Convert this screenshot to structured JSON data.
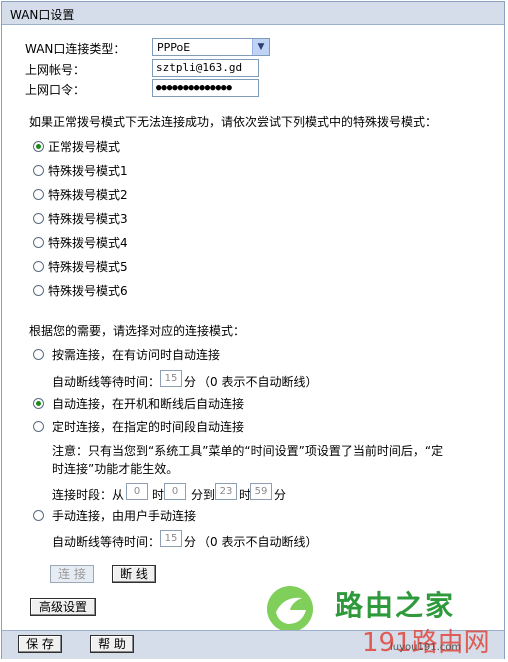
{
  "title": "WAN口设置",
  "wan": {
    "type_label": "WAN口连接类型：",
    "type_value": "PPPoE",
    "account_label": "上网帐号：",
    "account_value": "sztpli@163.gd",
    "password_label": "上网口令：",
    "password_value": "●●●●●●●●●●●●●●"
  },
  "dial_hint": "如果正常拨号模式下无法连接成功，请依次尝试下列模式中的特殊拨号模式：",
  "dial_modes": [
    {
      "label": "正常拨号模式",
      "checked": true
    },
    {
      "label": "特殊拨号模式1",
      "checked": false
    },
    {
      "label": "特殊拨号模式2",
      "checked": false
    },
    {
      "label": "特殊拨号模式3",
      "checked": false
    },
    {
      "label": "特殊拨号模式4",
      "checked": false
    },
    {
      "label": "特殊拨号模式5",
      "checked": false
    },
    {
      "label": "特殊拨号模式6",
      "checked": false
    }
  ],
  "conn_hint": "根据您的需要，请选择对应的连接模式：",
  "conn_modes": {
    "on_demand": "按需连接，在有访问时自动连接",
    "auto": "自动连接，在开机和断线后自动连接",
    "timed": "定时连接，在指定的时间段自动连接",
    "manual": "手动连接，由用户手动连接",
    "selected": "auto"
  },
  "idle": {
    "label": "自动断线等待时间：",
    "value": "15",
    "unit": "分",
    "note": "（0 表示不自动断线）"
  },
  "timed_note_line1": "注意：只有当您到“系统工具”菜单的“时间设置”项设置了当前时间后，“定",
  "timed_note_line2": "时连接”功能才能生效。",
  "period": {
    "label": "连接时段：从",
    "from_hour": "0",
    "hour_unit": "时",
    "from_min": "0",
    "to_label": "分到",
    "to_hour": "23",
    "to_min": "59",
    "min_unit": "分"
  },
  "idle2": {
    "label": "自动断线等待时间：",
    "value": "15",
    "unit": "分",
    "note": "（0 表示不自动断线）"
  },
  "buttons": {
    "connect": "连 接",
    "disconnect": "断 线",
    "advanced": "高级设置",
    "save": "保 存",
    "help": "帮 助"
  },
  "watermark": {
    "text": "路由之家",
    "num": "191路由网",
    "sub": "luyou191.com"
  }
}
